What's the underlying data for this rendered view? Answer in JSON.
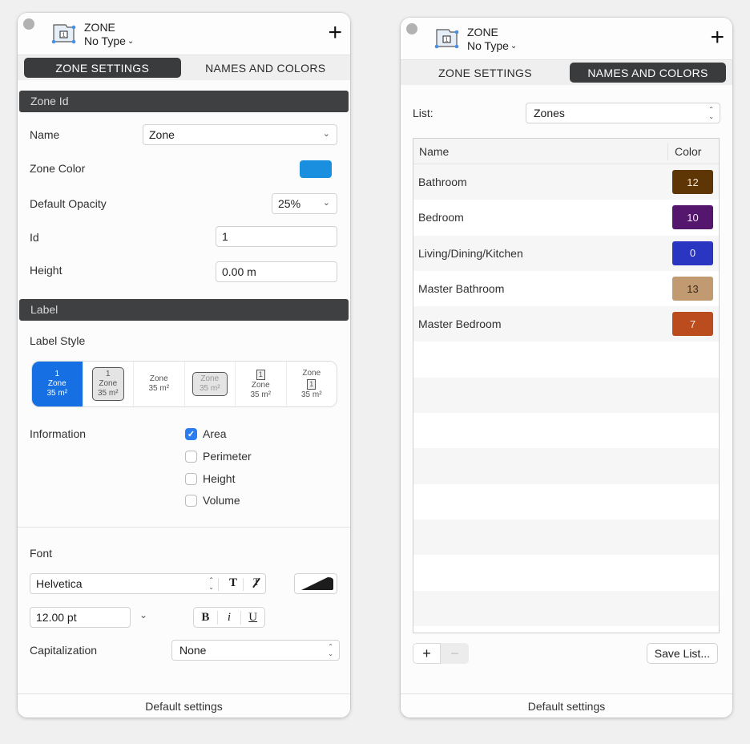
{
  "common": {
    "object_type": "ZONE",
    "type_selector": "No Type",
    "add_button": "+",
    "footer": "Default settings",
    "tabs": [
      "ZONE SETTINGS",
      "NAMES AND COLORS"
    ]
  },
  "left_panel": {
    "active_tab": "ZONE SETTINGS",
    "zone_id_section": {
      "header": "Zone Id",
      "name_label": "Name",
      "name_value": "Zone",
      "zone_color_label": "Zone Color",
      "zone_color": "#1a8fe0",
      "opacity_label": "Default Opacity",
      "opacity_value": "25%",
      "id_label": "Id",
      "id_value": "1",
      "height_label": "Height",
      "height_value": "0.00 m"
    },
    "label_section": {
      "header": "Label",
      "label_style_label": "Label Style",
      "styles": [
        {
          "lines": [
            "1",
            "Zone",
            "35 m²"
          ],
          "selected": true
        },
        {
          "lines": [
            "1",
            "Zone",
            "35 m²"
          ],
          "selected": false
        },
        {
          "lines": [
            "Zone",
            "35 m²"
          ],
          "selected": false
        },
        {
          "lines": [
            "Zone",
            "35 m²"
          ],
          "selected": false
        },
        {
          "lines": [
            "1",
            "Zone",
            "35 m²"
          ],
          "selected": false
        },
        {
          "lines": [
            "Zone",
            "1",
            "35 m²"
          ],
          "selected": false
        }
      ],
      "information_label": "Information",
      "information_options": [
        {
          "label": "Area",
          "checked": true
        },
        {
          "label": "Perimeter",
          "checked": false
        },
        {
          "label": "Height",
          "checked": false
        },
        {
          "label": "Volume",
          "checked": false
        }
      ]
    },
    "font_section": {
      "font_label": "Font",
      "font_family": "Helvetica",
      "font_size": "12.00 pt",
      "style_buttons": [
        "B",
        "i",
        "U"
      ],
      "font_tool_buttons": [
        "T",
        "T"
      ],
      "capitalization_label": "Capitalization",
      "capitalization_value": "None"
    }
  },
  "right_panel": {
    "active_tab": "NAMES AND COLORS",
    "list_label": "List:",
    "list_value": "Zones",
    "table": {
      "columns": [
        "Name",
        "Color"
      ],
      "rows": [
        {
          "name": "Bathroom",
          "color_index": "12",
          "color": "#5e3504",
          "text_color": "#f4e6d2"
        },
        {
          "name": "Bedroom",
          "color_index": "10",
          "color": "#55166e",
          "text_color": "#f1e4f6"
        },
        {
          "name": "Living/Dining/Kitchen",
          "color_index": "0",
          "color": "#2a35c2",
          "text_color": "#e8eaff"
        },
        {
          "name": "Master Bathroom",
          "color_index": "13",
          "color": "#c19a72",
          "text_color": "#3a2a18"
        },
        {
          "name": "Master Bedroom",
          "color_index": "7",
          "color": "#bb4c1e",
          "text_color": "#fde8dc"
        }
      ]
    },
    "add_row": "+",
    "remove_row": "−",
    "save_list": "Save List..."
  }
}
